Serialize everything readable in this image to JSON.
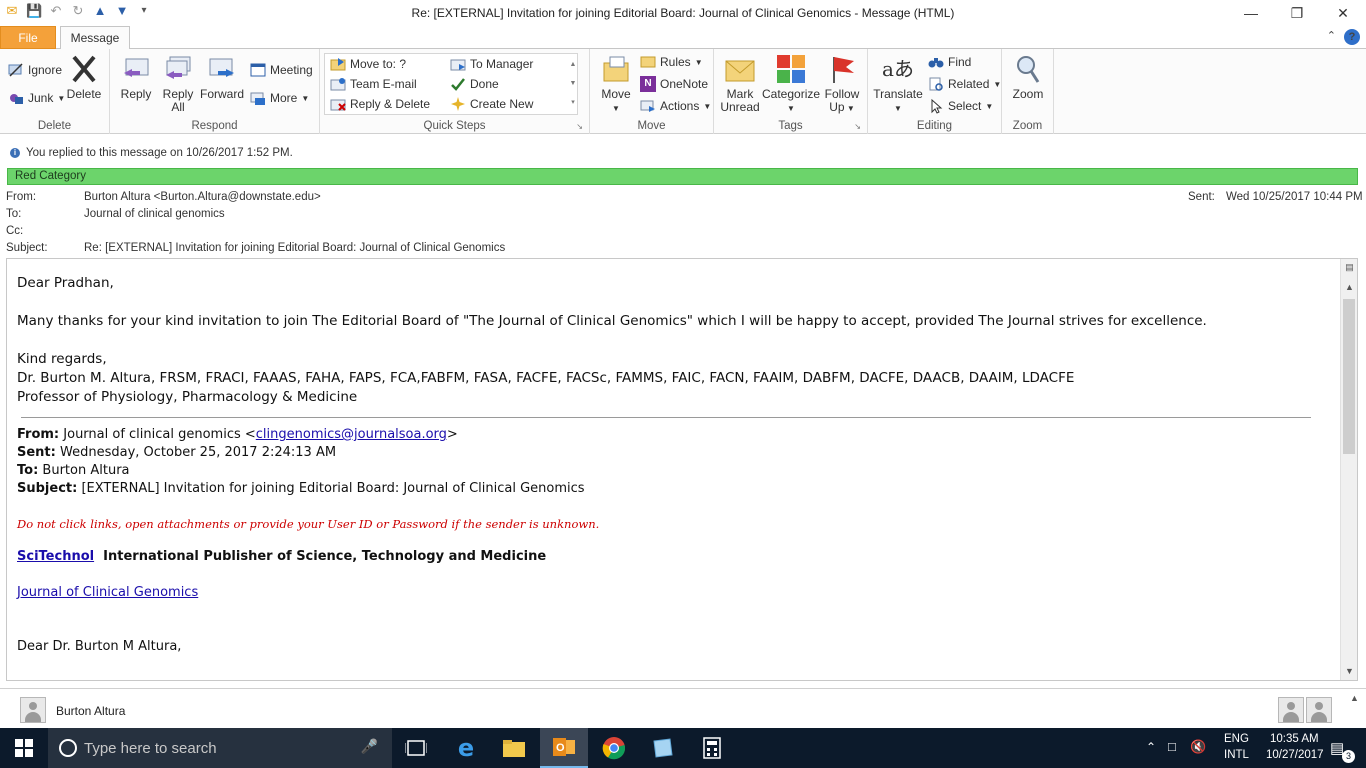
{
  "window": {
    "title": "Re: [EXTERNAL]  Invitation for joining Editorial Board: Journal of Clinical Genomics  -  Message (HTML)"
  },
  "tabs": {
    "file": "File",
    "message": "Message"
  },
  "ribbon": {
    "delete_group": {
      "label": "Delete",
      "ignore": "Ignore",
      "junk": "Junk",
      "delete": "Delete"
    },
    "respond_group": {
      "label": "Respond",
      "reply": "Reply",
      "reply_all_1": "Reply",
      "reply_all_2": "All",
      "forward": "Forward",
      "meeting": "Meeting",
      "more": "More"
    },
    "quick_steps": {
      "label": "Quick Steps",
      "items": [
        "Move to: ?",
        "Team E-mail",
        "Reply & Delete",
        "To Manager",
        "Done",
        "Create New"
      ]
    },
    "move_group": {
      "label": "Move",
      "move": "Move",
      "rules": "Rules",
      "onenote": "OneNote",
      "actions": "Actions"
    },
    "tags_group": {
      "label": "Tags",
      "mark_unread_1": "Mark",
      "mark_unread_2": "Unread",
      "categorize": "Categorize",
      "follow_up_1": "Follow",
      "follow_up_2": "Up"
    },
    "editing_group": {
      "label": "Editing",
      "translate": "Translate",
      "find": "Find",
      "related": "Related",
      "select": "Select"
    },
    "zoom_group": {
      "label": "Zoom",
      "zoom": "Zoom"
    }
  },
  "info": {
    "replied": "You replied to this message on 10/26/2017 1:52 PM.",
    "category": "Red Category",
    "category_color": "#6cd46b"
  },
  "headers": {
    "from_label": "From:",
    "from_value": "Burton Altura <Burton.Altura@downstate.edu>",
    "to_label": "To:",
    "to_value": "Journal of clinical genomics",
    "cc_label": "Cc:",
    "subject_label": "Subject:",
    "subject_value": "Re: [EXTERNAL]  Invitation for joining Editorial Board: Journal of Clinical Genomics",
    "sent_label": "Sent:",
    "sent_value": "Wed 10/25/2017 10:44 PM"
  },
  "body": {
    "greeting": "Dear Pradhan,",
    "para1": "Many thanks for your kind invitation to join The Editorial Board of \"The Journal of Clinical Genomics\" which I will be happy to accept, provided The Journal strives for excellence.",
    "regards": "Kind regards,",
    "sig1": "Dr. Burton M. Altura, FRSM, FRACI, FAAAS, FAHA, FAPS, FCA,FABFM, FASA, FACFE, FACSc, FAMMS, FAIC, FACN, FAAIM, DABFM, DACFE, DAACB, DAAIM, LDACFE",
    "sig2": "Professor of Physiology, Pharmacology & Medicine",
    "orig_from_label": "From:",
    "orig_from_value": "Journal of clinical genomics <",
    "orig_from_email": "clingenomics@journalsoa.org",
    "orig_from_close": ">",
    "orig_sent_label": "Sent:",
    "orig_sent_value": "Wednesday, October 25, 2017 2:24:13 AM",
    "orig_to_label": "To:",
    "orig_to_value": "Burton Altura",
    "orig_subject_label": "Subject:",
    "orig_subject_value": "[EXTERNAL] Invitation for joining Editorial Board: Journal of Clinical Genomics",
    "warning": "Do not click links, open attachments or provide your User ID or Password if the sender is unknown.",
    "publisher_link": "SciTechnol",
    "publisher_text": "International Publisher of Science, Technology and Medicine",
    "journal_link": "Journal of Clinical Genomics",
    "greeting2": "Dear Dr.  Burton M Altura,"
  },
  "people_pane": {
    "name": "Burton Altura"
  },
  "taskbar": {
    "search_placeholder": "Type here to search",
    "lang1": "ENG",
    "lang2": "INTL",
    "time": "10:35 AM",
    "date": "10/27/2017",
    "notifications": "3"
  }
}
